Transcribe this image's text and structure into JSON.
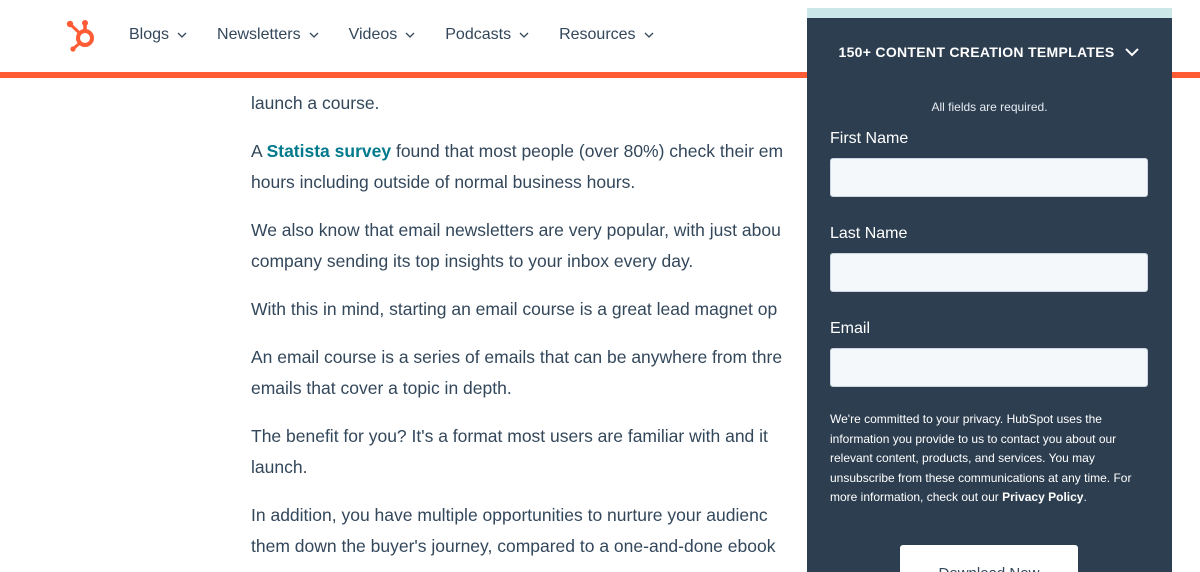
{
  "nav": {
    "items": [
      {
        "label": "Blogs"
      },
      {
        "label": "Newsletters"
      },
      {
        "label": "Videos"
      },
      {
        "label": "Podcasts"
      },
      {
        "label": "Resources"
      }
    ]
  },
  "article": {
    "p0": "launch a course.",
    "p1_prefix": "A ",
    "p1_link": "Statista survey",
    "p1_line1_rest": " found that most people (over 80%) check their em",
    "p1_line2": "hours including outside of normal business hours.",
    "p2_line1": "We also know that email newsletters are very popular, with just abou",
    "p2_line2": "company sending its top insights to your inbox every day.",
    "p3_line1": "With this in mind, starting an email course is a great lead magnet op",
    "p4_line1": "An email course is a series of emails that can be anywhere from thre",
    "p4_line2": "emails that cover a topic in depth.",
    "p5_line1": "The benefit for you? It's a format most users are familiar with and it",
    "p5_line2": "launch.",
    "p6_line1": "In addition, you have multiple opportunities to nurture your audienc",
    "p6_line2": "them down the buyer's journey, compared to a one-and-done ebook"
  },
  "form": {
    "header": "150+ CONTENT CREATION TEMPLATES",
    "required_note": "All fields are required.",
    "first_name_label": "First Name",
    "first_name_value": "",
    "last_name_label": "Last Name",
    "last_name_value": "",
    "email_label": "Email",
    "email_value": "",
    "privacy_text": "We're committed to your privacy. HubSpot uses the information you provide to us to contact you about our relevant content, products, and services. You may unsubscribe from these communications at any time. For more information, check out our ",
    "privacy_link": "Privacy Policy",
    "privacy_end": ".",
    "download_label": "Download Now"
  },
  "colors": {
    "accent": "#ff5c35",
    "panel_bg": "#2d3e50",
    "link": "#007a8c",
    "panel_top_strip": "#cbe7e8"
  },
  "icons": {
    "logo": "hubspot-sprocket-icon",
    "nav_chevron": "chevron-down-icon",
    "panel_chevron": "chevron-down-icon"
  }
}
